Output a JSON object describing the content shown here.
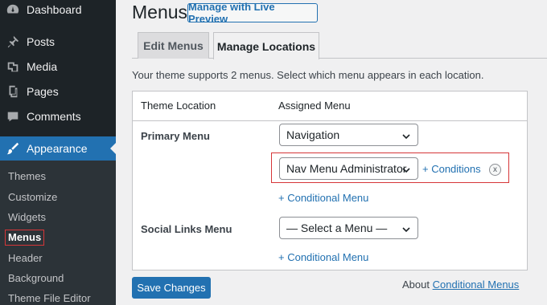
{
  "sidebar": {
    "items": [
      {
        "label": "Dashboard",
        "icon": "dashboard-icon"
      },
      {
        "label": "Posts",
        "icon": "pin-icon"
      },
      {
        "label": "Media",
        "icon": "media-icon"
      },
      {
        "label": "Pages",
        "icon": "pages-icon"
      },
      {
        "label": "Comments",
        "icon": "comment-icon"
      },
      {
        "label": "Appearance",
        "icon": "brush-icon"
      }
    ],
    "submenu": [
      "Themes",
      "Customize",
      "Widgets",
      "Menus",
      "Header",
      "Background",
      "Theme File Editor"
    ]
  },
  "header": {
    "title": "Menus",
    "preview_button": "Manage with Live Preview"
  },
  "tabs": [
    {
      "label": "Edit Menus"
    },
    {
      "label": "Manage Locations"
    }
  ],
  "intro": "Your theme supports 2 menus. Select which menu appears in each location.",
  "table": {
    "col_location": "Theme Location",
    "col_assigned": "Assigned Menu",
    "rows": [
      {
        "label": "Primary Menu",
        "selected": "Navigation",
        "conditional_selected": "Nav Menu Administrator",
        "conditions_link": "+ Conditions",
        "remove": "x",
        "add_link": "+ Conditional Menu"
      },
      {
        "label": "Social Links Menu",
        "selected": "— Select a Menu —",
        "add_link": "+ Conditional Menu"
      }
    ]
  },
  "footer": {
    "save_button": "Save Changes",
    "about_prefix": "About",
    "about_link": "Conditional Menus"
  },
  "colors": {
    "accent": "#2271b1",
    "sidebar_bg": "#1d2327",
    "highlight": "#d63638"
  }
}
